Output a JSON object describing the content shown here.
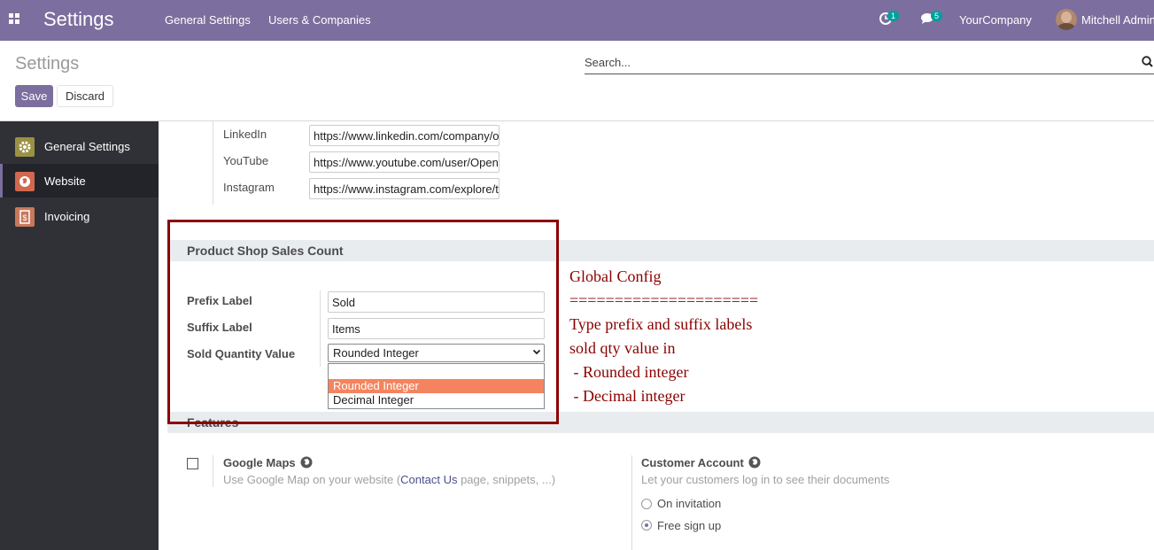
{
  "navbar": {
    "app_title": "Settings",
    "menu": [
      "General Settings",
      "Users & Companies"
    ],
    "activity_count": "1",
    "message_count": "5",
    "company": "YourCompany",
    "user": "Mitchell Admin"
  },
  "control_panel": {
    "title": "Settings",
    "save_label": "Save",
    "discard_label": "Discard",
    "search_placeholder": "Search..."
  },
  "sidebar": {
    "items": [
      {
        "label": "General Settings",
        "icon": "gear-icon",
        "color": "#9a9144"
      },
      {
        "label": "Website",
        "icon": "globe-icon",
        "color": "#d1684f"
      },
      {
        "label": "Invoicing",
        "icon": "invoice-icon",
        "color": "#c9785b"
      }
    ]
  },
  "social": [
    {
      "label": "LinkedIn",
      "value": "https://www.linkedin.com/company/odoo"
    },
    {
      "label": "YouTube",
      "value": "https://www.youtube.com/user/OpenERPonline"
    },
    {
      "label": "Instagram",
      "value": "https://www.instagram.com/explore/tags/odoo/"
    }
  ],
  "product_shop": {
    "section_title": "Product Shop Sales Count",
    "prefix_label": "Prefix Label",
    "prefix_value": "Sold",
    "suffix_label": "Suffix Label",
    "suffix_value": "Items",
    "qty_label": "Sold Quantity Value",
    "qty_value": "Rounded Integer",
    "options": [
      "",
      "Rounded Integer",
      "Decimal Integer"
    ]
  },
  "annotation": [
    "Global Config",
    "=====================",
    "Type prefix and suffix labels",
    "sold qty value in",
    " - Rounded integer",
    " - Decimal integer"
  ],
  "features": {
    "section_title": "Features",
    "google_maps": {
      "title": "Google Maps",
      "desc_before": "Use Google Map on your website (",
      "desc_link": "Contact Us",
      "desc_after": " page, snippets, ...)"
    },
    "customer_account": {
      "title": "Customer Account",
      "desc": "Let your customers log in to see their documents",
      "options": [
        "On invitation",
        "Free sign up"
      ],
      "selected": "Free sign up"
    }
  },
  "colors": {
    "brand": "#7c6e9e",
    "annotation": "#8b0000",
    "dropdown_highlight": "#f4845f"
  }
}
